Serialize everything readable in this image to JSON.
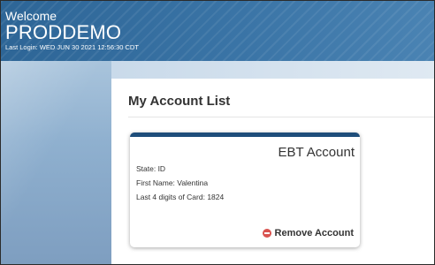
{
  "header": {
    "welcome": "Welcome",
    "username": "PRODDEMO",
    "last_login": "Last Login: WED JUN 30 2021 12:56:30 CDT"
  },
  "main": {
    "title": "My Account List"
  },
  "account_card": {
    "title": "EBT Account",
    "state": "State: ID",
    "first_name": "First Name: Valentina",
    "card_digits": "Last 4 digits of Card: 1824",
    "remove_label": "Remove Account"
  },
  "colors": {
    "header_blue": "#3a74a6",
    "card_accent": "#1e4d7a",
    "remove_red": "#d9534f"
  },
  "icons": {
    "remove": "minus-circle-icon"
  }
}
